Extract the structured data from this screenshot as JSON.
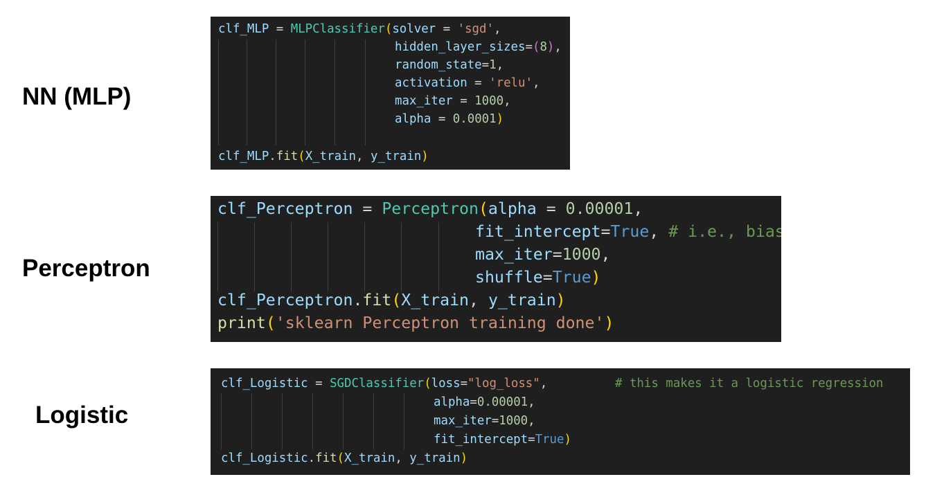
{
  "labels": {
    "mlp": "NN (MLP)",
    "perceptron": "Perceptron",
    "logistic": "Logistic"
  },
  "colors": {
    "code_background": "#1f1f1f",
    "variable": "#9cdcfe",
    "class": "#4ec9b0",
    "function": "#dcdcaa",
    "operator": "#d4d4d4",
    "string": "#ce9178",
    "number": "#b5cea8",
    "keyword": "#569cd6",
    "comment": "#6a9955",
    "bracket_level1": "#ffd700",
    "bracket_level2": "#da70d6"
  },
  "code": {
    "mlp": {
      "tokens": {
        "var": "clf_MLP",
        "eq": " = ",
        "cls": "MLPClassifier",
        "p_solver": "solver",
        "eq_sp": " = ",
        "v_solver": "'sgd'",
        "p_hidden": "hidden_layer_sizes",
        "v_hidden": "8",
        "p_random": "random_state",
        "v_random": "1",
        "p_activation": "activation",
        "v_activation": "'relu'",
        "p_max_iter": "max_iter",
        "v_max_iter": "1000",
        "p_alpha": "alpha",
        "v_alpha": "0.0001",
        "fit_var": "clf_MLP",
        "fit_fn": "fit",
        "arg_x": "X_train",
        "arg_y": "y_train"
      }
    },
    "perceptron": {
      "tokens": {
        "var": "clf_Perceptron",
        "cls": "Perceptron",
        "p_alpha": "alpha",
        "v_alpha": "0.00001",
        "p_fit_intercept": "fit_intercept",
        "v_fit_intercept": "True",
        "comment": "# i.e., bias",
        "p_max_iter": "max_iter",
        "v_max_iter": "1000",
        "p_shuffle": "shuffle",
        "v_shuffle": "True",
        "fit_var": "clf_Perceptron",
        "fit_fn": "fit",
        "arg_x": "X_train",
        "arg_y": "y_train",
        "print_fn": "print",
        "print_str": "'sklearn Perceptron training done'"
      }
    },
    "logistic": {
      "tokens": {
        "var": "clf_Logistic",
        "cls": "SGDClassifier",
        "p_loss": "loss",
        "v_loss": "\"log_loss\"",
        "comment": "# this makes it a logistic regression",
        "p_alpha": "alpha",
        "v_alpha": "0.00001",
        "p_max_iter": "max_iter",
        "v_max_iter": "1000",
        "p_fit_intercept": "fit_intercept",
        "v_fit_intercept": "True",
        "fit_var": "clf_Logistic",
        "fit_fn": "fit",
        "arg_x": "X_train",
        "arg_y": "y_train"
      }
    }
  }
}
